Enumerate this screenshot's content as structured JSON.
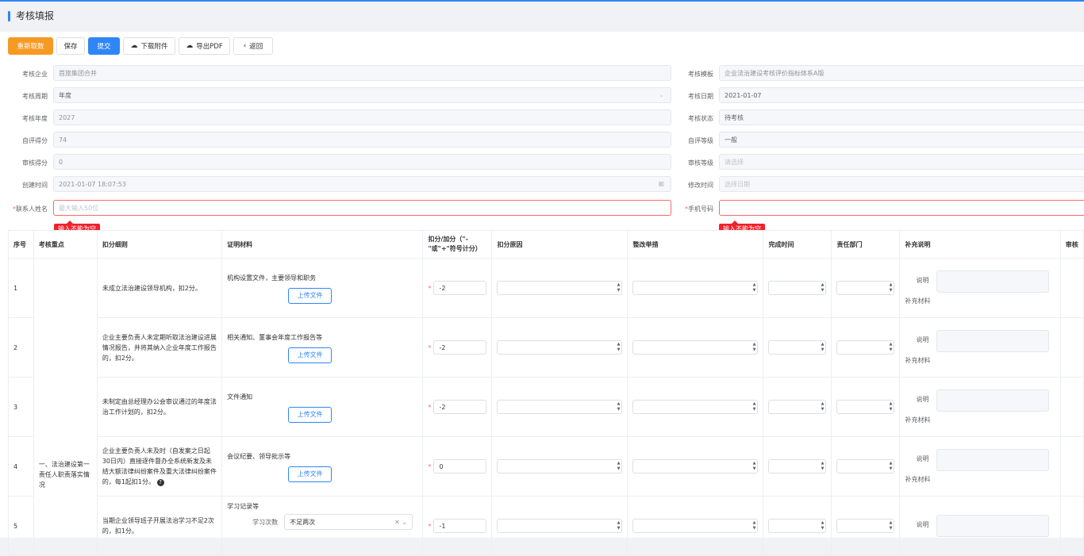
{
  "page": {
    "title": "考核填报"
  },
  "toolbar": {
    "refetch_label": "重新取数",
    "save_label": "保存",
    "submit_label": "提交",
    "download_label": "下载附件",
    "export_label": "导出PDF",
    "back_label": "返回"
  },
  "form": {
    "enterprise": {
      "label": "考核企业",
      "value": "首旅集团合并"
    },
    "template": {
      "label": "考核模板",
      "value": "企业法治建设考核评价指标体系A版"
    },
    "period": {
      "label": "考核周期",
      "value": "年度"
    },
    "date": {
      "label": "考核日期",
      "value": "2021-01-07"
    },
    "year": {
      "label": "考核年度",
      "value": "2027"
    },
    "status": {
      "label": "考核状态",
      "value": "待考核"
    },
    "self_score": {
      "label": "自评得分",
      "value": "74"
    },
    "self_grade": {
      "label": "自评等级",
      "value": "一般"
    },
    "audit_score": {
      "label": "审核得分",
      "value": "0"
    },
    "audit_grade": {
      "label": "审核等级",
      "placeholder": "请选择"
    },
    "created": {
      "label": "创建时间",
      "value": "2021-01-07 18:07:53"
    },
    "modified": {
      "label": "修改时间",
      "placeholder": "选择日期"
    },
    "contact": {
      "label": "联系人姓名",
      "placeholder": "最大输入50位",
      "error": "输入不能为空"
    },
    "phone": {
      "label": "手机号码",
      "placeholder": "",
      "error": "输入不能为空"
    }
  },
  "table": {
    "headers": [
      "序号",
      "考核重点",
      "扣分细则",
      "证明材料",
      "扣分/加分（\"-\"或\"+\"符号计分）",
      "扣分原因",
      "整改举措",
      "完成时间",
      "责任部门",
      "补充说明",
      "审核"
    ],
    "group_label": "一、法治建设第一责任人职责落实情况",
    "upload_label": "上传文件",
    "note_label": "说明",
    "supplement_label": "补充材料",
    "rows": [
      {
        "no": "1",
        "rule": "未成立法治建设领导机构，扣2分。",
        "material": "机构设置文件，主要领导和职务",
        "score": "-2"
      },
      {
        "no": "2",
        "rule": "企业主要负责人未定期听取法治建设进展情况报告，并将其纳入企业年度工作报告的，扣2分。",
        "material": "相关通知、董事会年度工作报告等",
        "score": "-2"
      },
      {
        "no": "3",
        "rule": "未制定由总经理办公会审议通过的年度法治工作计划的，扣2分。",
        "material": "文件通知",
        "score": "-2"
      },
      {
        "no": "4",
        "rule": "企业主要负责人未及时（自发案之日起30日内）直接逐件督办全系统新发及未结大额法律纠纷案件及重大法律纠纷案件的，每1起扣1分。",
        "material": "会议纪要、领导批示等",
        "score": "0"
      },
      {
        "no": "5",
        "rule": "当期企业领导班子开展法治学习不足2次的，扣1分。",
        "material": "学习记录等",
        "score": "-1",
        "study_label": "学习次数",
        "study_value": "不足两次"
      }
    ]
  }
}
